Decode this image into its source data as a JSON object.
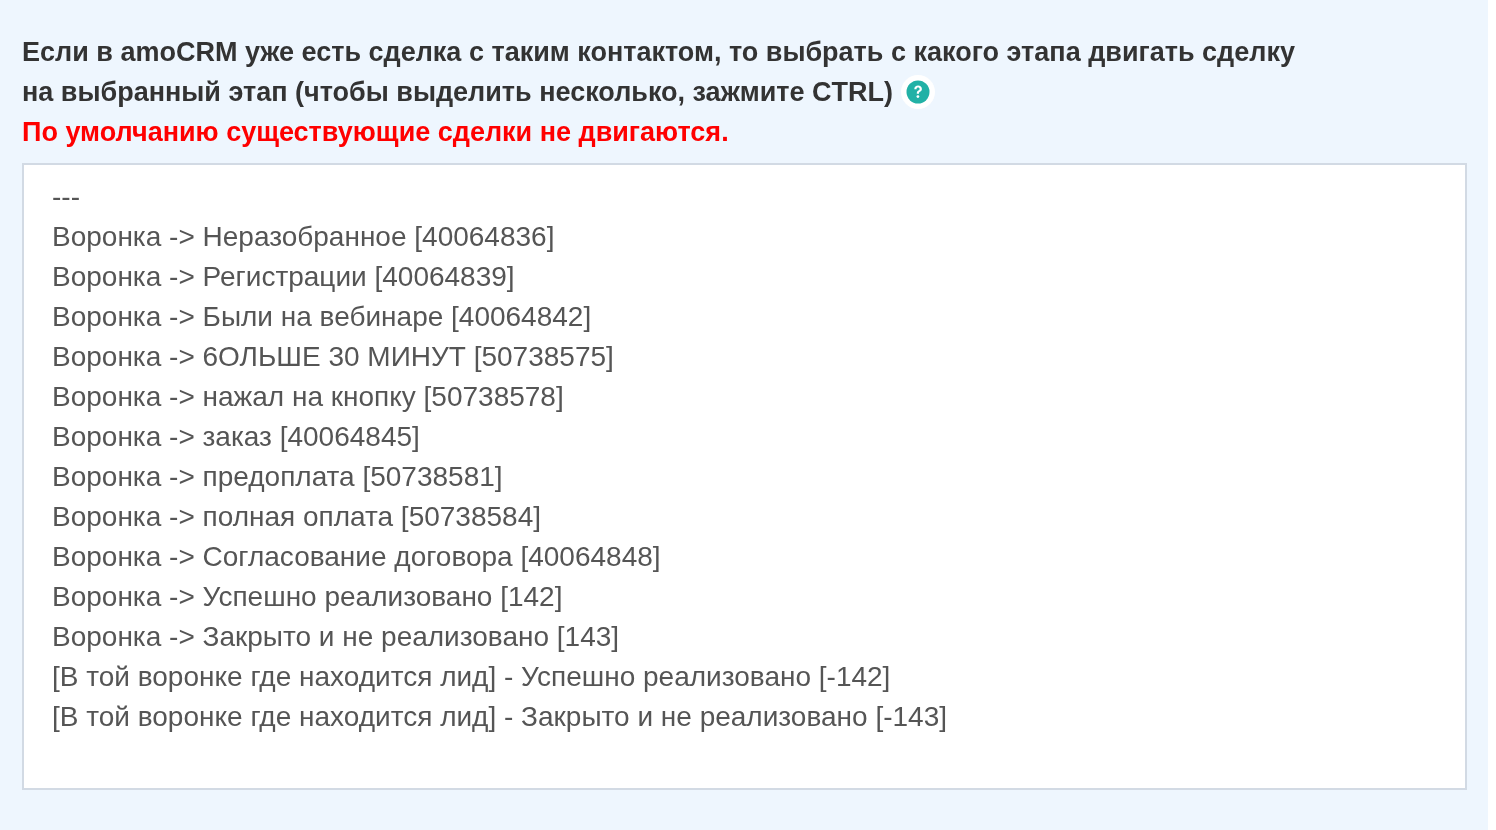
{
  "label_lines": [
    "Если в amoCRM уже есть сделка с таким контактом, то выбрать с какого этапа двигать сделку",
    "на выбранный этап (чтобы выделить несколько, зажмите CTRL)"
  ],
  "notice": "По умолчанию существующие сделки не двигаются.",
  "stage_list": {
    "options": [
      {
        "label": "---",
        "selected": false
      },
      {
        "label": "Воронка -> Неразобранное [40064836]",
        "selected": false
      },
      {
        "label": "Воронка -> Регистрации [40064839]",
        "selected": false
      },
      {
        "label": "Воронка -> Были на вебинаре [40064842]",
        "selected": false
      },
      {
        "label": "Воронка -> 6ОЛЬШЕ 30 МИНУТ [50738575]",
        "selected": false
      },
      {
        "label": "Воронка -> нажал на кнопку [50738578]",
        "selected": false
      },
      {
        "label": "Воронка -> заказ [40064845]",
        "selected": false
      },
      {
        "label": "Воронка -> предоплата [50738581]",
        "selected": false
      },
      {
        "label": "Воронка -> полная оплата [50738584]",
        "selected": false
      },
      {
        "label": "Воронка -> Согласование договора [40064848]",
        "selected": false
      },
      {
        "label": "Воронка -> Успешно реализовано [142]",
        "selected": false
      },
      {
        "label": "Воронка -> Закрыто и не реализовано [143]",
        "selected": false
      },
      {
        "label": "[В той воронке где находится лид] - Успешно реализовано [-142]",
        "selected": false
      },
      {
        "label": "[В той воронке где находится лид] - Закрыто и не реализовано [-143]",
        "selected": false
      }
    ]
  }
}
